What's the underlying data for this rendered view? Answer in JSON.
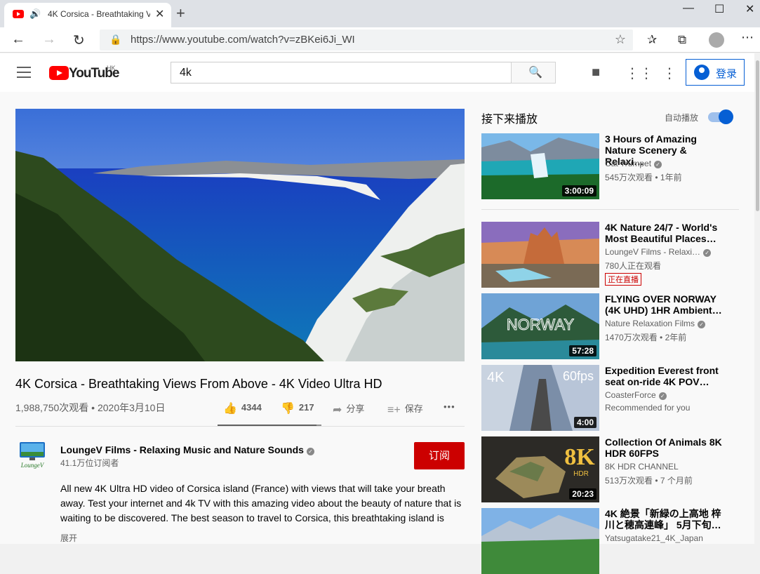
{
  "browser": {
    "tab_title": "4K Corsica - Breathtaking Views From Above",
    "url": "https://www.youtube.com/watch?v=zBKei6Ji_WI"
  },
  "yt": {
    "logo_text": "YouTube",
    "region": "HK",
    "search_value": "4k",
    "signin_label": "登录"
  },
  "video": {
    "title": "4K Corsica - Breathtaking Views From Above - 4K Video Ultra HD",
    "meta": "1,988,750次观看 • 2020年3月10日",
    "likes": "4344",
    "dislikes": "217",
    "like_ratio": 0.952,
    "share_label": "分享",
    "save_label": "保存",
    "more_label": "•••"
  },
  "channel": {
    "name": "LoungeV Films - Relaxing Music and Nature Sounds",
    "subs": "41.1万位订阅者",
    "subscribe_label": "订阅",
    "avatar_text": "LoungeV"
  },
  "description": {
    "text": "All new 4K Ultra HD video of Corsica island (France) with views that will take your breath away. Test your internet and 4k TV with this amazing video about the beauty of nature that is waiting to be discovered. The best season to travel to Corsica, this breathtaking island is",
    "show_more": "展开"
  },
  "sidebar": {
    "up_next": "接下来播放",
    "autoplay": "自动播放",
    "autoplay_on": true,
    "items": [
      {
        "title": "3 Hours of Amazing Nature Scenery & Relaxi…",
        "channel": "Cat Trumpet",
        "views": "545万次观看 • 1年前",
        "duration": "3:00:09",
        "verified": true
      },
      {
        "title": "4K Nature 24/7 - World's Most Beautiful Places…",
        "channel": "LoungeV Films - Relaxi…",
        "views": "780人正在观看",
        "badge": "正在直播",
        "verified": true
      },
      {
        "title": "FLYING OVER NORWAY (4K UHD) 1HR Ambient…",
        "channel": "Nature Relaxation Films",
        "views": "1470万次观看 • 2年前",
        "duration": "57:28",
        "thumb_text": "NORWAY",
        "verified": true
      },
      {
        "title": "Expedition Everest front seat on-ride 4K POV…",
        "channel": "CoasterForce",
        "views": "Recommended for you",
        "duration": "4:00",
        "thumb_text_left": "4K",
        "thumb_text_right": "60fps",
        "verified": true
      },
      {
        "title": "Collection Of Animals 8K HDR 60FPS",
        "channel": "8K HDR CHANNEL",
        "views": "513万次观看 • 7 个月前",
        "duration": "20:23",
        "thumb_text": "8K",
        "thumb_sub": "HDR"
      },
      {
        "title": "4K 絶景「新緑の上高地 梓川と穂高連峰」 5月下旬…",
        "channel": "Yatsugatake21_4K_Japan",
        "views": ""
      }
    ]
  },
  "colors": {
    "accent": "#065fd4",
    "subscribe": "#cc0000",
    "brand": "#ff0000"
  }
}
